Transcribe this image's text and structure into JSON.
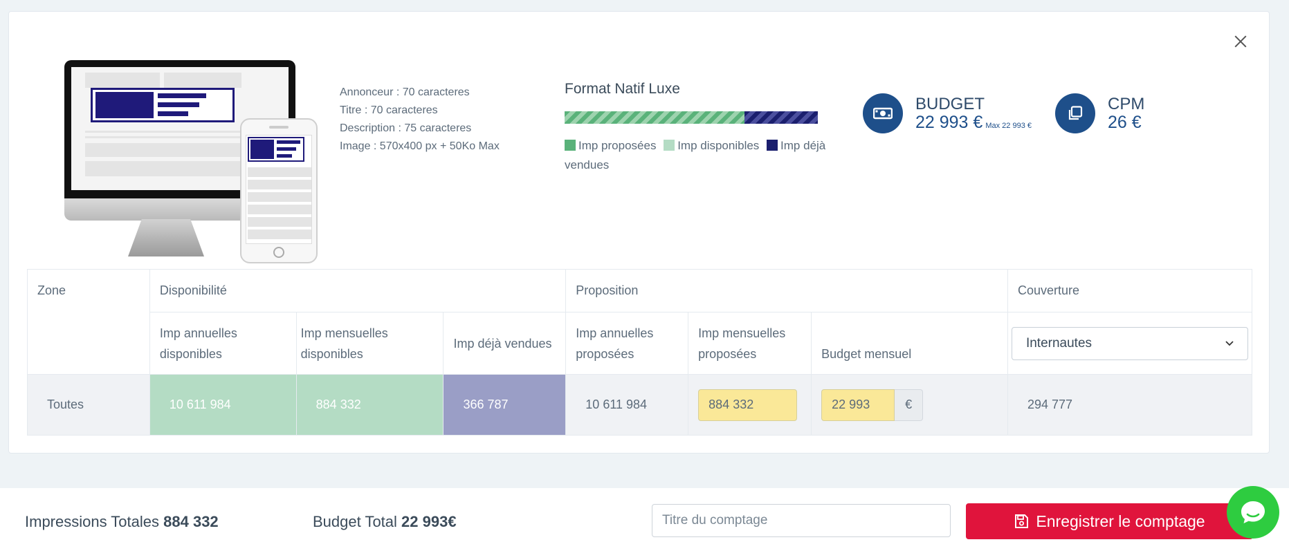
{
  "specs": {
    "annonceur": "Annonceur : 70 caracteres",
    "titre": "Titre : 70 caracteres",
    "description": "Description : 75 caracteres",
    "image": "Image : 570x400 px + 50Ko Max"
  },
  "format": {
    "title": "Format Natif Luxe",
    "proposed_fraction": 0.71,
    "sold_fraction": 0.29,
    "legend": {
      "proposed": "Imp proposées",
      "available": "Imp disponibles",
      "sold": "Imp déjà vendues"
    },
    "colors": {
      "proposed": "#5ab27a",
      "available": "#b4dcc4",
      "sold": "#1b1f6e"
    }
  },
  "kpis": {
    "budget_label": "BUDGET",
    "budget_value": "22 993 €",
    "budget_max": "Max  22 993 €",
    "cpm_label": "CPM",
    "cpm_value": "26 €"
  },
  "table": {
    "headers": {
      "zone": "Zone",
      "disponibilite": "Disponibilité",
      "proposition": "Proposition",
      "couverture": "Couverture"
    },
    "subheaders": {
      "imp_annuelles_dispo": "Imp annuelles disponibles",
      "imp_mensuelles_dispo": "Imp mensuelles disponibles",
      "imp_deja_vendues": "Imp déjà vendues",
      "imp_annuelles_prop": "Imp annuelles proposées",
      "imp_mensuelles_prop": "Imp mensuelles proposées",
      "budget_mensuel": "Budget mensuel"
    },
    "couverture_select": "Internautes",
    "row": {
      "zone": "Toutes",
      "annuelles_dispo": "10 611 984",
      "mensuelles_dispo": "884 332",
      "deja_vendues": "366 787",
      "annuelles_prop": "10 611 984",
      "mensuelles_prop": "884 332",
      "budget_mensuel": "22 993",
      "currency": "€",
      "couverture": "294 777"
    }
  },
  "footer": {
    "impressions_label": "Impressions Totales",
    "impressions_value": "884 332",
    "budget_label": "Budget Total",
    "budget_value": "22 993€",
    "title_placeholder": "Titre du comptage",
    "save_label": "Enregistrer le comptage"
  }
}
